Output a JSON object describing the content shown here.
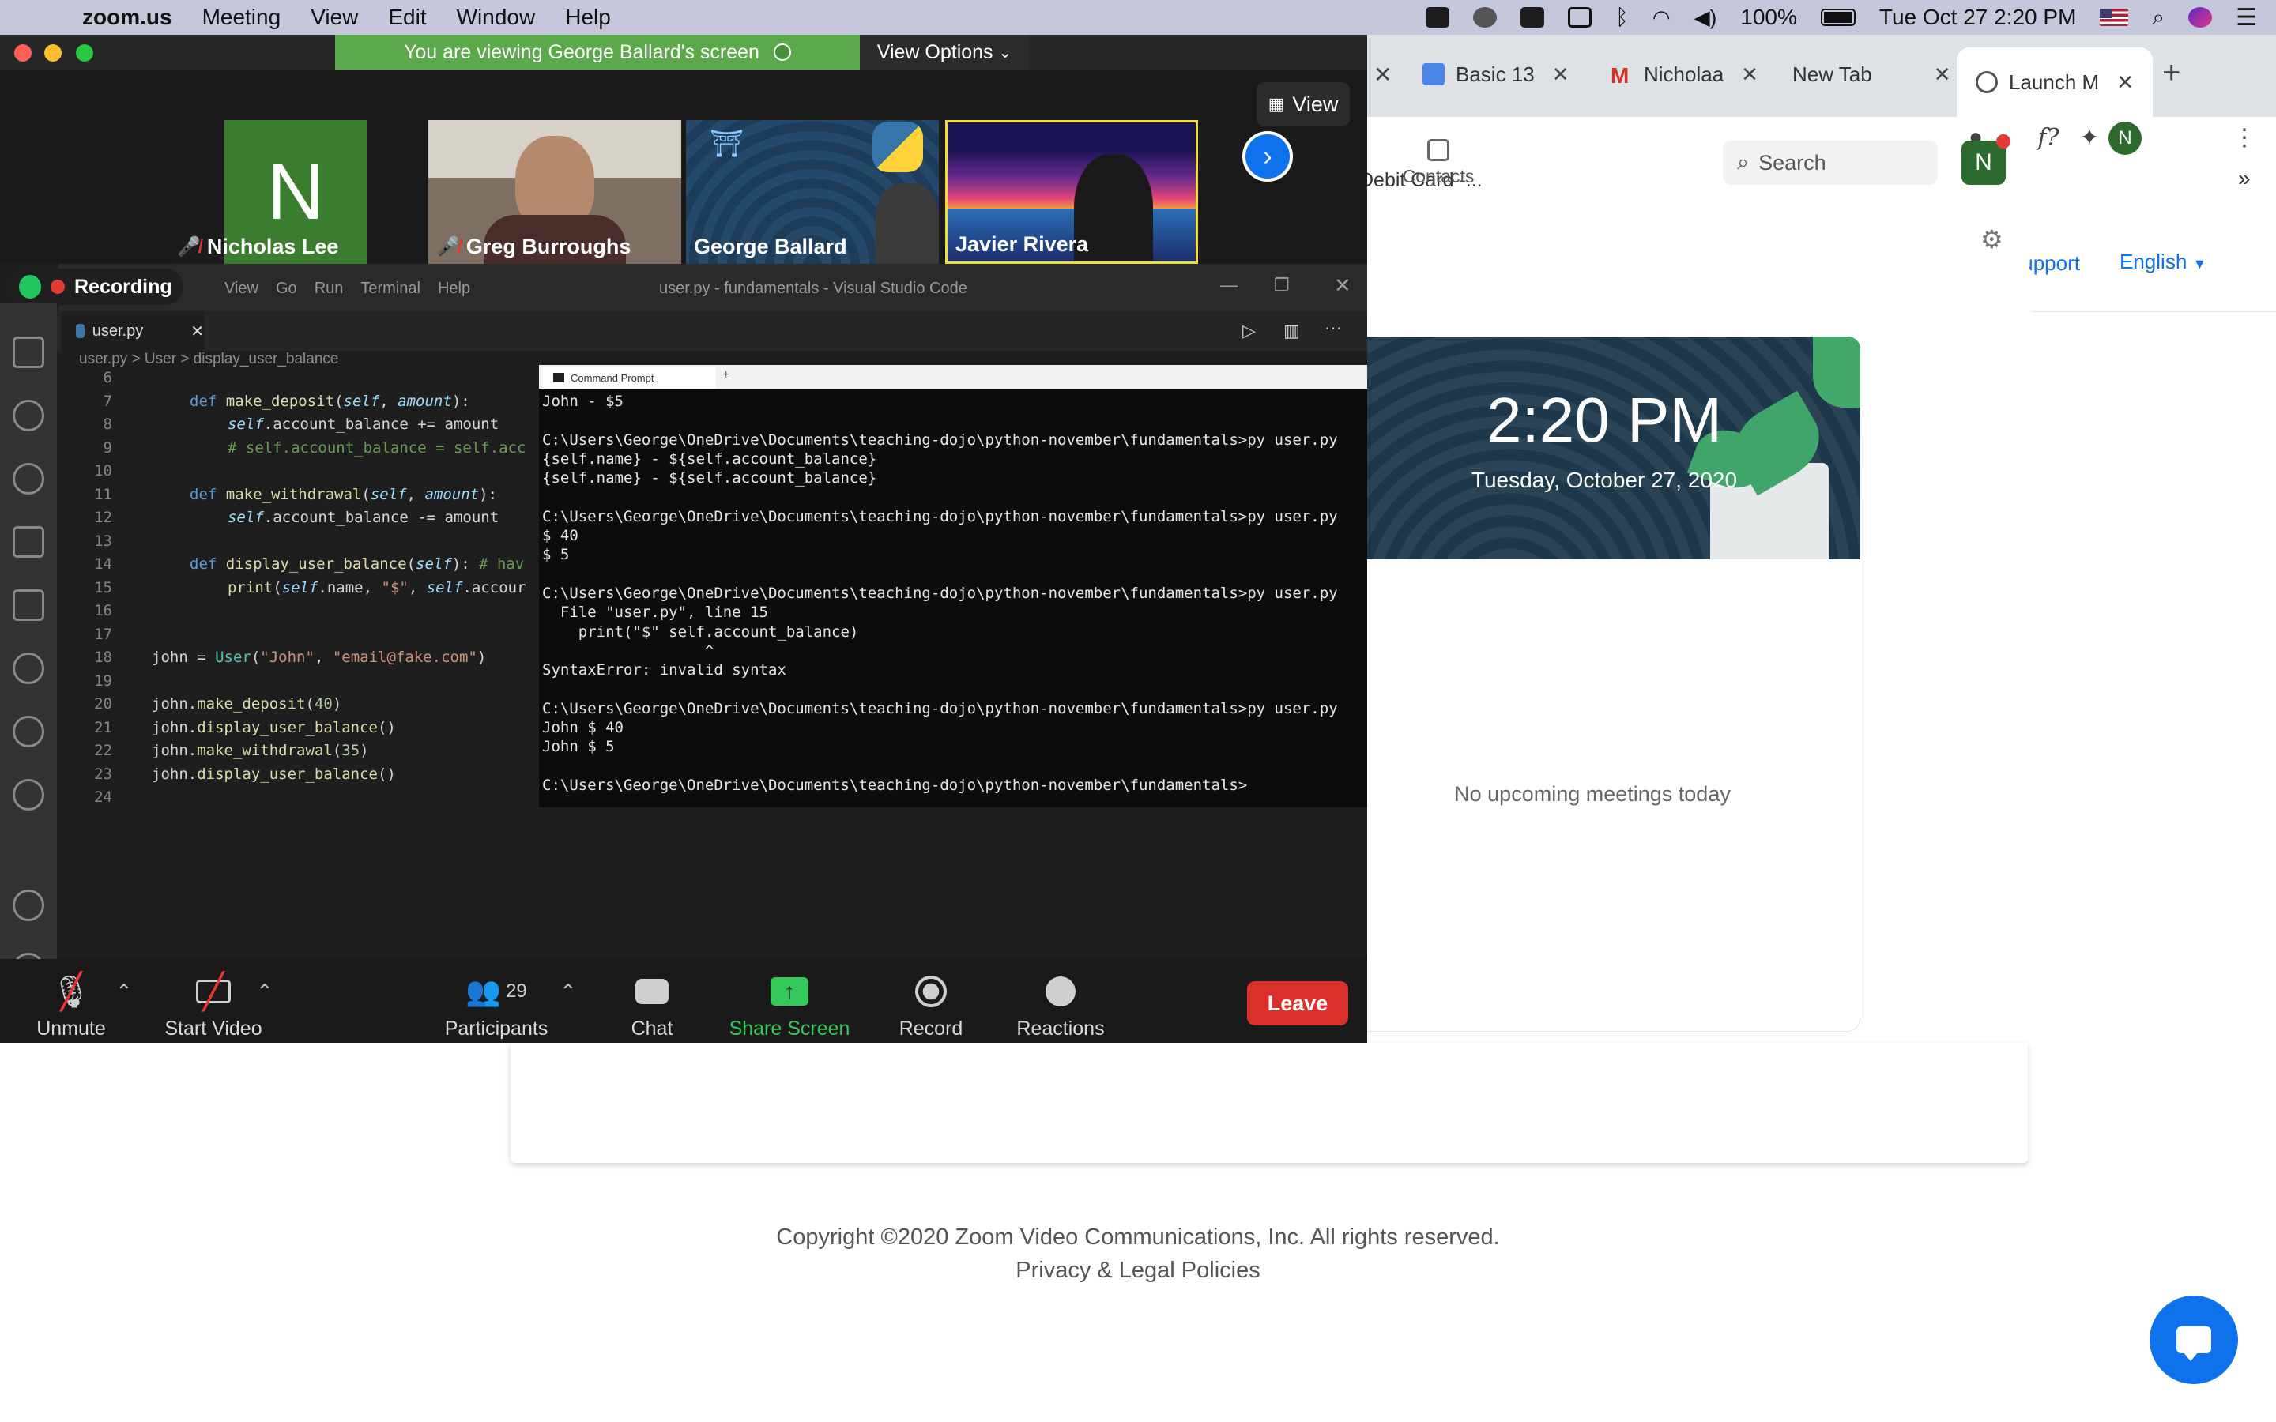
{
  "menubar": {
    "app": "zoom.us",
    "items": [
      "Meeting",
      "View",
      "Edit",
      "Window",
      "Help"
    ],
    "battery": "100%",
    "datetime": "Tue Oct 27  2:20 PM"
  },
  "browser": {
    "tabs": [
      {
        "label": "Basic 13"
      },
      {
        "label": "Nicholaa"
      },
      {
        "label": "New Tab"
      },
      {
        "label": "Launch M"
      }
    ],
    "search_placeholder": "Search",
    "contacts_label": "Contacts",
    "profile_initial": "N",
    "bookmark": "Debit Card -...",
    "support_link": "Support",
    "language": "English",
    "clock_time": "2:20 PM",
    "clock_date": "Tuesday, October 27, 2020",
    "no_meetings": "No upcoming meetings today",
    "copyright": "Copyright ©2020 Zoom Video Communications, Inc. All rights reserved.",
    "privacy": "Privacy & Legal Policies"
  },
  "zoom": {
    "banner": "You are viewing George Ballard's screen",
    "view_options": "View Options",
    "view_button": "View",
    "participants": [
      {
        "name": "Nicholas Lee",
        "muted": true
      },
      {
        "name": "Greg Burroughs",
        "muted": true
      },
      {
        "name": "George Ballard",
        "muted": false
      },
      {
        "name": "Javier Rivera",
        "muted": false
      }
    ],
    "recording": "Recording",
    "toolbar": {
      "unmute": "Unmute",
      "start_video": "Start Video",
      "participants": "Participants",
      "participant_count": "29",
      "chat": "Chat",
      "share_screen": "Share Screen",
      "record": "Record",
      "reactions": "Reactions",
      "leave": "Leave"
    }
  },
  "vscode": {
    "menus": [
      "View",
      "Go",
      "Run",
      "Terminal",
      "Help"
    ],
    "title": "user.py - fundamentals - Visual Studio Code",
    "tab": "user.py",
    "breadcrumb": "user.py  >  User  >  display_user_balance"
  },
  "cmd": {
    "tab": "Command Prompt",
    "output": "John - $5\n\nC:\\Users\\George\\OneDrive\\Documents\\teaching-dojo\\python-november\\fundamentals>py user.py\n{self.name} - ${self.account_balance}\n{self.name} - ${self.account_balance}\n\nC:\\Users\\George\\OneDrive\\Documents\\teaching-dojo\\python-november\\fundamentals>py user.py\n$ 40\n$ 5\n\nC:\\Users\\George\\OneDrive\\Documents\\teaching-dojo\\python-november\\fundamentals>py user.py\n  File \"user.py\", line 15\n    print(\"$\" self.account_balance)\n                  ^\nSyntaxError: invalid syntax\n\nC:\\Users\\George\\OneDrive\\Documents\\teaching-dojo\\python-november\\fundamentals>py user.py\nJohn $ 40\nJohn $ 5\n\nC:\\Users\\George\\OneDrive\\Documents\\teaching-dojo\\python-november\\fundamentals>"
  }
}
